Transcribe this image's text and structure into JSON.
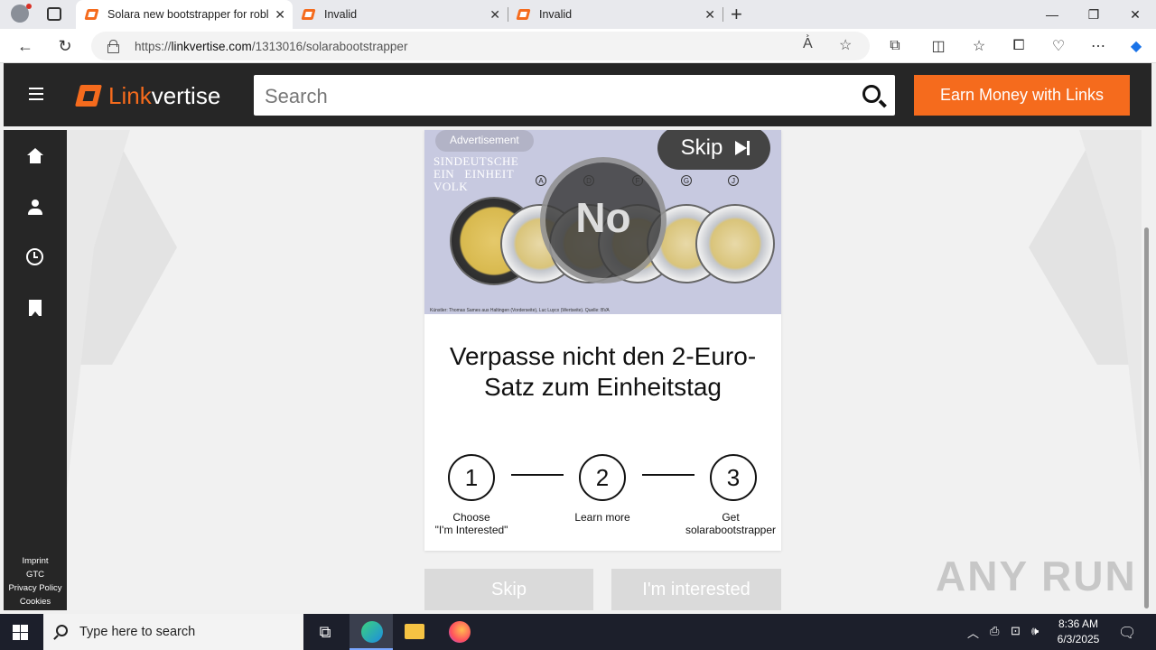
{
  "browser": {
    "tabs": [
      {
        "title": "Solara new bootstrapper for robl",
        "active": true
      },
      {
        "title": "Invalid",
        "active": false
      },
      {
        "title": "Invalid",
        "active": false
      }
    ],
    "url_prefix": "https://",
    "url_host": "linkvertise.com",
    "url_path": "/1313016/solarabootstrapper"
  },
  "site": {
    "logo_part1": "Link",
    "logo_part2": "vertise",
    "search_placeholder": "Search",
    "earn_button": "Earn Money with Links",
    "footer_links": [
      "Imprint",
      "GTC",
      "Privacy Policy",
      "Cookies"
    ]
  },
  "ad": {
    "label": "Advertisement",
    "image_text": "SINDEUTSCHE\nEIN   EINHEIT\nVOLK",
    "coin_letters": [
      "A",
      "D",
      "F",
      "G",
      "J"
    ],
    "overlay_text": "No",
    "skip_label": "Skip",
    "small_print": "Künstler: Thomas Sames aus Haltingen (Vorderseite), Luc Luycx (Wertseite). Quelle: BVA",
    "headline": "Verpasse nicht den 2-Euro-Satz zum Einheitstag"
  },
  "steps": [
    {
      "number": "1",
      "label": "Choose\n\"I'm Interested\""
    },
    {
      "number": "2",
      "label": "Learn more"
    },
    {
      "number": "3",
      "label": "Get\nsolarabootstrapper"
    }
  ],
  "actions": {
    "skip": "Skip",
    "interested": "I'm interested"
  },
  "watermark": "ANY RUN",
  "taskbar": {
    "search_placeholder": "Type here to search",
    "time": "8:36 AM",
    "date": "6/3/2025"
  },
  "colors": {
    "brand_orange": "#f56b1d",
    "header_dark": "#262626"
  }
}
